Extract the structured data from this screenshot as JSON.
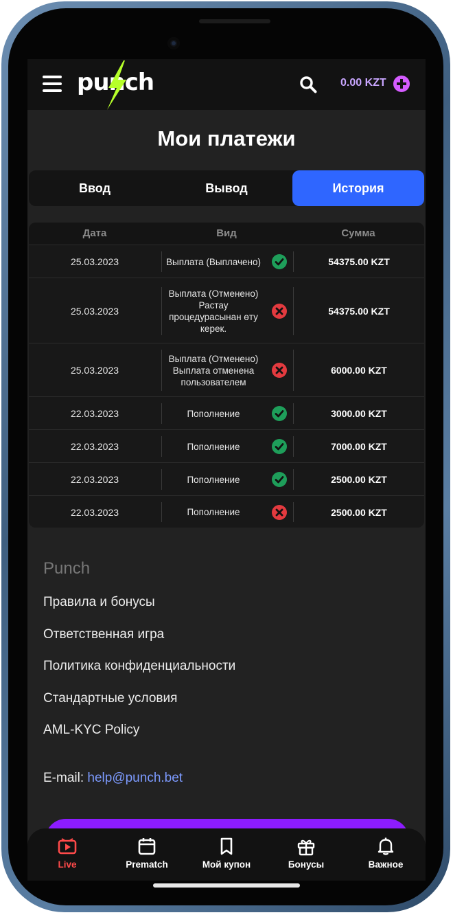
{
  "header": {
    "logo_text": "punch",
    "balance": "0.00 KZT"
  },
  "page_title": "Мои платежи",
  "tabs": [
    {
      "label": "Ввод",
      "active": false
    },
    {
      "label": "Вывод",
      "active": false
    },
    {
      "label": "История",
      "active": true
    }
  ],
  "table": {
    "headers": [
      "Дата",
      "Вид",
      "Сумма"
    ],
    "rows": [
      {
        "date": "25.03.2023",
        "type": "Выплата (Выплачено)",
        "status": "success",
        "amount": "54375.00 KZT"
      },
      {
        "date": "25.03.2023",
        "type": "Выплата (Отменено) Растау процедурасынан өту керек.",
        "status": "failed",
        "amount": "54375.00 KZT"
      },
      {
        "date": "25.03.2023",
        "type": "Выплата (Отменено) Выплата отменена пользователем",
        "status": "failed",
        "amount": "6000.00 KZT"
      },
      {
        "date": "22.03.2023",
        "type": "Пополнение",
        "status": "success",
        "amount": "3000.00 KZT"
      },
      {
        "date": "22.03.2023",
        "type": "Пополнение",
        "status": "success",
        "amount": "7000.00 KZT"
      },
      {
        "date": "22.03.2023",
        "type": "Пополнение",
        "status": "success",
        "amount": "2500.00 KZT"
      },
      {
        "date": "22.03.2023",
        "type": "Пополнение",
        "status": "failed",
        "amount": "2500.00 KZT"
      }
    ]
  },
  "footer": {
    "brand": "Punch",
    "links": [
      "Правила и бонусы",
      "Ответственная игра",
      "Политика конфиденциальности",
      "Стандартные условия",
      "AML-KYC Policy"
    ],
    "email_label": "E-mail:",
    "email": "help@punch.bet"
  },
  "bottom_nav": [
    {
      "label": "Live",
      "icon": "live-tv-icon",
      "active": true
    },
    {
      "label": "Prematch",
      "icon": "calendar-icon",
      "active": false
    },
    {
      "label": "Мой купон",
      "icon": "coupon-icon",
      "active": false
    },
    {
      "label": "Бонусы",
      "icon": "gift-icon",
      "active": false
    },
    {
      "label": "Важное",
      "icon": "bell-icon",
      "active": false
    }
  ],
  "colors": {
    "accent_blue": "#2f66ff",
    "balance_purple": "#c9a6ff",
    "success": "#1e9e5a",
    "error": "#e33a3f",
    "live_red": "#ff4a4a",
    "logo_bolt": "#b6ff2a"
  }
}
